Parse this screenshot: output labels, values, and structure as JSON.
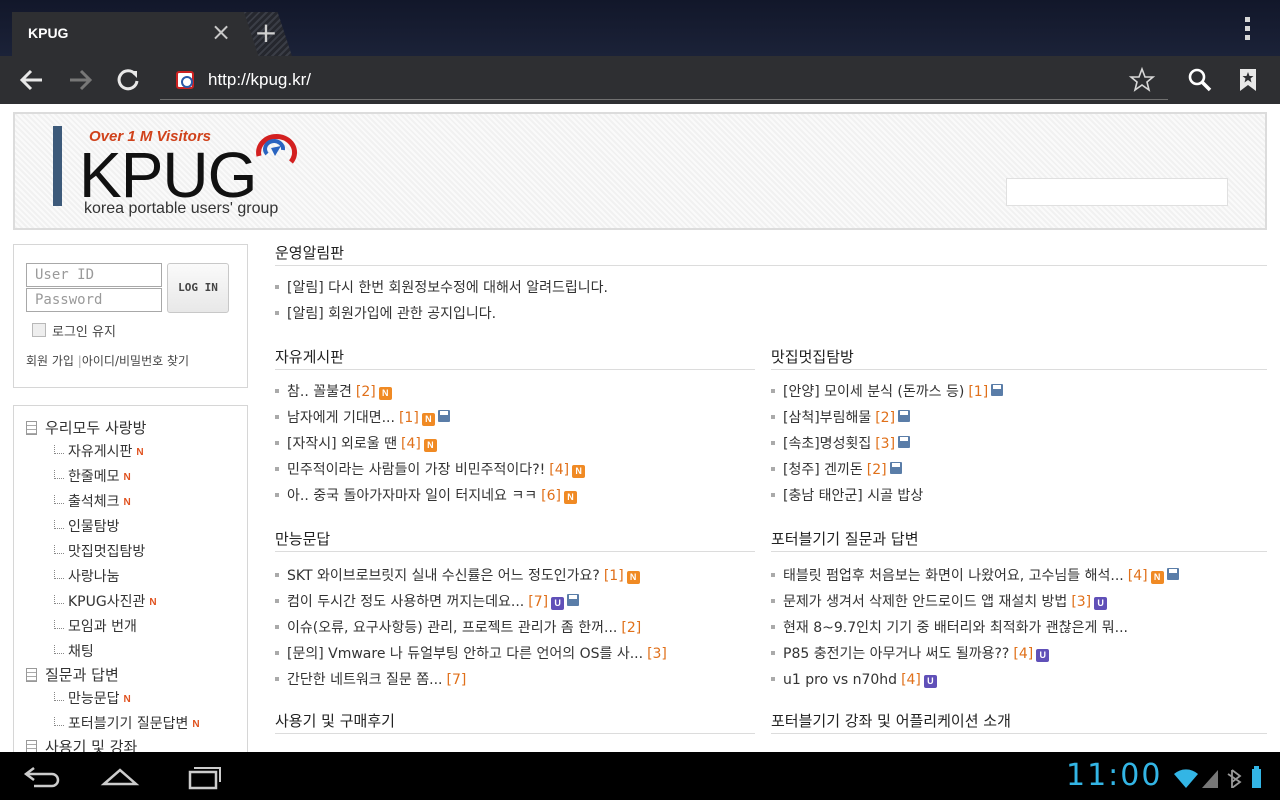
{
  "browser": {
    "tab_title": "KPUG",
    "tab_close": "×",
    "new_tab": "+",
    "url": "http://kpug.kr/"
  },
  "header": {
    "visitors_badge": "Over 1 M Visitors",
    "logo_text": "KPUG",
    "tagline": "korea portable users' group"
  },
  "login": {
    "userid_placeholder": "User ID",
    "password_placeholder": "Password",
    "login_button": "LOG IN",
    "remember_label": "로그인 유지",
    "signup_link": "회원 가입",
    "find_link": "아이디/비밀번호 찾기"
  },
  "sidenav": {
    "cat1": "우리모두 사랑방",
    "cat1_items": [
      "자유게시판",
      "한줄메모",
      "출석체크",
      "인물탐방",
      "맛집멋집탐방",
      "사랑나눔",
      "KPUG사진관",
      "모임과 번개",
      "채팅"
    ],
    "cat2": "질문과 답변",
    "cat2_items": [
      "만능문답",
      "포터블기기 질문답변"
    ],
    "cat3": "사용기 및 강좌",
    "new_mark": "N"
  },
  "boards": {
    "notice": {
      "title": "운영알림판",
      "items": [
        "[알림] 다시 한번 회원정보수정에 대해서 알려드립니다.",
        "[알림] 회원가입에 관한 공지입니다."
      ]
    },
    "free": {
      "title": "자유게시판",
      "items": [
        "참.. 꼴불견",
        "남자에게 기대면...",
        "[자작시] 외로울 땐",
        "민주적이라는 사람들이 가장 비민주적이다?!",
        "아.. 중국 돌아가자마자 일이 터지네요 ㅋㅋ"
      ],
      "counts": [
        "[2]",
        "[1]",
        "[4]",
        "[4]",
        "[6]"
      ]
    },
    "food": {
      "title": "맛집멋집탐방",
      "items": [
        "[안양] 모이세 분식 (돈까스 등)",
        "[삼척]부림해물",
        "[속초]명성횟집",
        "[청주] 겐끼돈",
        "[충남 태안군] 시골 밥상"
      ],
      "counts": [
        "[1]",
        "[2]",
        "[3]",
        "[2]",
        ""
      ]
    },
    "qa": {
      "title": "만능문답",
      "items": [
        "SKT 와이브로브릿지 실내 수신률은 어느 정도인가요?",
        "컴이 두시간 정도 사용하면 꺼지는데요...",
        "이슈(오류, 요구사항등) 관리, 프로젝트 관리가 좀 한꺼...",
        "[문의] Vmware 나 듀얼부팅 안하고 다른 언어의 OS를 사...",
        "간단한 네트워크 질문 쫌..."
      ],
      "counts": [
        "[1]",
        "[7]",
        "[2]",
        "[3]",
        "[7]"
      ]
    },
    "portable_qa": {
      "title": "포터블기기 질문과 답변",
      "items": [
        "태블릿 펌업후 처음보는 화면이 나왔어요, 고수님들 해석...",
        "문제가 생겨서 삭제한 안드로이드 앱 재설치 방법",
        "현재 8~9.7인치 기기 중 배터리와 최적화가 괜찮은게 뭐...",
        "P85 충전기는 아무거나 써도 될까용??",
        "u1 pro vs n70hd"
      ],
      "counts": [
        "[4]",
        "[3]",
        "",
        "[4]",
        "[4]"
      ]
    },
    "reviews": {
      "title": "사용기 및 구매후기"
    },
    "lectures": {
      "title": "포터블기기 강좌 및 어플리케이션 소개"
    },
    "badge_new": "N",
    "badge_update": "U"
  },
  "system": {
    "clock": "11:00"
  },
  "colors": {
    "accent_orange": "#e0701a",
    "clock_blue": "#33b5e5",
    "toolbar": "#2e2f32"
  }
}
